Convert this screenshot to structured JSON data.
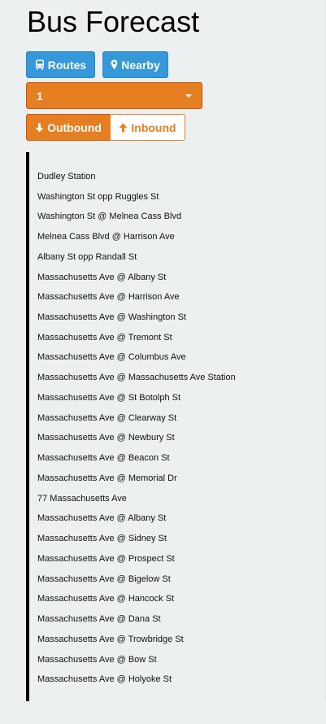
{
  "app": {
    "title": "Bus Forecast"
  },
  "nav": {
    "routes_label": "Routes",
    "routes_icon": "bus-icon",
    "nearby_label": "Nearby",
    "nearby_icon": "map-marker-icon"
  },
  "route_selector": {
    "selected": "1"
  },
  "direction": {
    "outbound_label": "Outbound",
    "outbound_icon": "arrow-down-icon",
    "inbound_label": "Inbound",
    "inbound_icon": "arrow-up-icon",
    "active": "Outbound"
  },
  "stops": [
    "Dudley Station",
    "Washington St opp Ruggles St",
    "Washington St @ Melnea Cass Blvd",
    "Melnea Cass Blvd @ Harrison Ave",
    "Albany St opp Randall St",
    "Massachusetts Ave @ Albany St",
    "Massachusetts Ave @ Harrison Ave",
    "Massachusetts Ave @ Washington St",
    "Massachusetts Ave @ Tremont St",
    "Massachusetts Ave @ Columbus Ave",
    "Massachusetts Ave @ Massachusetts Ave Station",
    "Massachusetts Ave @ St Botolph St",
    "Massachusetts Ave @ Clearway St",
    "Massachusetts Ave @ Newbury St",
    "Massachusetts Ave @ Beacon St",
    "Massachusetts Ave @ Memorial Dr",
    "77 Massachusetts Ave",
    "Massachusetts Ave @ Albany St",
    "Massachusetts Ave @ Sidney St",
    "Massachusetts Ave @ Prospect St",
    "Massachusetts Ave @ Bigelow St",
    "Massachusetts Ave @ Hancock St",
    "Massachusetts Ave @ Dana St",
    "Massachusetts Ave @ Trowbridge St",
    "Massachusetts Ave @ Bow St",
    "Massachusetts Ave @ Holyoke St"
  ],
  "colors": {
    "primary_blue": "#3498db",
    "accent_orange": "#e67e22",
    "background": "#ecf0f1"
  }
}
